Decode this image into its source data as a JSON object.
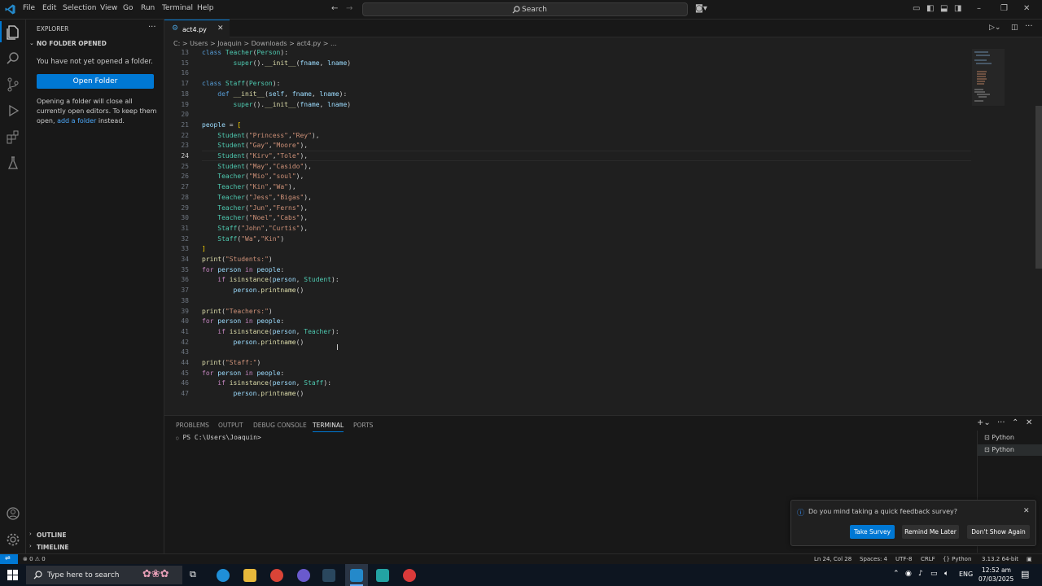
{
  "menu": [
    "File",
    "Edit",
    "Selection",
    "View",
    "Go",
    "Run",
    "Terminal",
    "Help"
  ],
  "search": {
    "label": "Search"
  },
  "sidebar": {
    "header": "EXPLORER",
    "section": "NO FOLDER OPENED",
    "message": "You have not yet opened a folder.",
    "open_folder_button": "Open Folder",
    "info_line1": "Opening a folder will close all",
    "info_line2": "currently open editors. To keep them",
    "info_line3_pre": "open,",
    "info_line3_link": "add a folder",
    "info_line3_post": "instead.",
    "outline": "OUTLINE",
    "timeline": "TIMELINE"
  },
  "tab": {
    "filename": "act4.py"
  },
  "breadcrumb": "C: > Users > Joaquin > Downloads > act4.py > ...",
  "code_lines": [
    {
      "n": "13",
      "html": "<span class='kw2'>class</span> <span class='cls'>Teacher</span>(<span class='cls'>Person</span>):"
    },
    {
      "n": "15",
      "html": "        <span class='cls'>super</span>().<span class='fn'>__init__</span>(<span class='var'>fname</span>, <span class='var'>lname</span>)"
    },
    {
      "n": "16",
      "html": ""
    },
    {
      "n": "17",
      "html": "<span class='kw2'>class</span> <span class='cls'>Staff</span>(<span class='cls'>Person</span>):"
    },
    {
      "n": "18",
      "html": "    <span class='kw2'>def</span> <span class='fn'>__init__</span>(<span class='var'>self</span>, <span class='var'>fname</span>, <span class='var'>lname</span>):"
    },
    {
      "n": "19",
      "html": "        <span class='cls'>super</span>().<span class='fn'>__init__</span>(<span class='var'>fname</span>, <span class='var'>lname</span>)"
    },
    {
      "n": "20",
      "html": ""
    },
    {
      "n": "21",
      "html": "<span class='var'>people</span> = <span class='br'>[</span>"
    },
    {
      "n": "22",
      "html": "    <span class='cls'>Student</span>(<span class='str'>\"Princess\"</span>,<span class='str'>\"Rey\"</span>),"
    },
    {
      "n": "23",
      "html": "    <span class='cls'>Student</span>(<span class='str'>\"Gay\"</span>,<span class='str'>\"Moore\"</span>),"
    },
    {
      "n": "24",
      "html": "    <span class='cls'>Student</span>(<span class='str'>\"Kirv\"</span>,<span class='str'>\"Tole\"</span>),"
    },
    {
      "n": "25",
      "html": "    <span class='cls'>Student</span>(<span class='str'>\"May\"</span>,<span class='str'>\"Casido\"</span>),"
    },
    {
      "n": "26",
      "html": "    <span class='cls'>Teacher</span>(<span class='str'>\"Mio\"</span>,<span class='str'>\"soul\"</span>),"
    },
    {
      "n": "27",
      "html": "    <span class='cls'>Teacher</span>(<span class='str'>\"Kin\"</span>,<span class='str'>\"Wa\"</span>),"
    },
    {
      "n": "28",
      "html": "    <span class='cls'>Teacher</span>(<span class='str'>\"Jess\"</span>,<span class='str'>\"Bigas\"</span>),"
    },
    {
      "n": "29",
      "html": "    <span class='cls'>Teacher</span>(<span class='str'>\"Jun\"</span>,<span class='str'>\"Ferns\"</span>),"
    },
    {
      "n": "30",
      "html": "    <span class='cls'>Teacher</span>(<span class='str'>\"Noel\"</span>,<span class='str'>\"Cabs\"</span>),"
    },
    {
      "n": "31",
      "html": "    <span class='cls'>Staff</span>(<span class='str'>\"John\"</span>,<span class='str'>\"Curtis\"</span>),"
    },
    {
      "n": "32",
      "html": "    <span class='cls'>Staff</span>(<span class='str'>\"Wa\"</span>,<span class='str'>\"Kin\"</span>)"
    },
    {
      "n": "33",
      "html": "<span class='br'>]</span>"
    },
    {
      "n": "34",
      "html": "<span class='fn'>print</span>(<span class='str'>\"Students:\"</span>)"
    },
    {
      "n": "35",
      "html": "<span class='kw'>for</span> <span class='var'>person</span> <span class='kw'>in</span> <span class='var'>people</span>:"
    },
    {
      "n": "36",
      "html": "    <span class='kw'>if</span> <span class='fn'>isinstance</span>(<span class='var'>person</span>, <span class='cls'>Student</span>):"
    },
    {
      "n": "37",
      "html": "        <span class='var'>person</span>.<span class='fn'>printname</span>()"
    },
    {
      "n": "38",
      "html": ""
    },
    {
      "n": "39",
      "html": "<span class='fn'>print</span>(<span class='str'>\"Teachers:\"</span>)"
    },
    {
      "n": "40",
      "html": "<span class='kw'>for</span> <span class='var'>person</span> <span class='kw'>in</span> <span class='var'>people</span>:"
    },
    {
      "n": "41",
      "html": "    <span class='kw'>if</span> <span class='fn'>isinstance</span>(<span class='var'>person</span>, <span class='cls'>Teacher</span>):"
    },
    {
      "n": "42",
      "html": "        <span class='var'>person</span>.<span class='fn'>printname</span>()"
    },
    {
      "n": "43",
      "html": ""
    },
    {
      "n": "44",
      "html": "<span class='fn'>print</span>(<span class='str'>\"Staff:\"</span>)"
    },
    {
      "n": "45",
      "html": "<span class='kw'>for</span> <span class='var'>person</span> <span class='kw'>in</span> <span class='var'>people</span>:"
    },
    {
      "n": "46",
      "html": "    <span class='kw'>if</span> <span class='fn'>isinstance</span>(<span class='var'>person</span>, <span class='cls'>Staff</span>):"
    },
    {
      "n": "47",
      "html": "        <span class='var'>person</span>.<span class='fn'>printname</span>()"
    }
  ],
  "panel": {
    "tabs": [
      "PROBLEMS",
      "OUTPUT",
      "DEBUG CONSOLE",
      "TERMINAL",
      "PORTS"
    ],
    "terminal_prompt": "PS C:\\Users\\Joaquin>",
    "terminals": [
      "Python",
      "Python"
    ]
  },
  "notification": {
    "message": "Do you mind taking a quick feedback survey?",
    "take_survey": "Take Survey",
    "remind_later": "Remind Me Later",
    "dont_show": "Don't Show Again"
  },
  "status": {
    "problems": "⊗ 0 ⚠ 0",
    "position": "Ln 24, Col 28",
    "spaces": "Spaces: 4",
    "encoding": "UTF-8",
    "eol": "CRLF",
    "language": "{} Python",
    "interpreter": "3.13.2 64-bit"
  },
  "taskbar": {
    "search_placeholder": "Type here to search",
    "lang": "ENG",
    "time": "12:52 am",
    "date": "07/03/2025"
  },
  "colors": {
    "accent": "#0078d4",
    "editor_bg": "#1f1f1f",
    "chrome_bg": "#181818"
  }
}
